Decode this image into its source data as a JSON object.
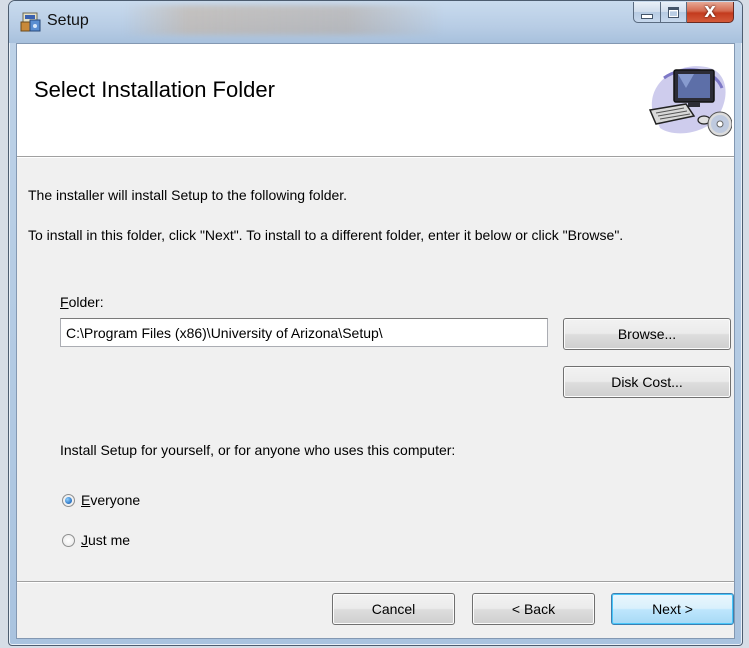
{
  "window": {
    "title": "Setup",
    "close_glyph": "X"
  },
  "banner": {
    "title": "Select Installation Folder",
    "icon": "computer-with-cd-icon"
  },
  "body": {
    "line1": "The installer will install Setup to the following folder.",
    "line2": "To install in this folder, click \"Next\". To install to a different folder, enter it below or click \"Browse\".",
    "folder_label_accel": "F",
    "folder_label_rest": "older:",
    "folder_value": "C:\\Program Files (x86)\\University of Arizona\\Setup\\",
    "browse_label": "Browse...",
    "disk_cost_label": "Disk Cost...",
    "scope_prompt": "Install Setup for yourself, or for anyone who uses this computer:",
    "options": [
      {
        "accel": "E",
        "rest": "veryone",
        "checked": true
      },
      {
        "accel": "J",
        "rest": "ust me",
        "checked": false
      }
    ]
  },
  "footer": {
    "cancel_label": "Cancel",
    "back_label": "< Back",
    "next_label": "Next >"
  },
  "colors": {
    "accent": "#48c6fa",
    "window_frame": "#bfd3e8",
    "close_red": "#c33b1e"
  }
}
